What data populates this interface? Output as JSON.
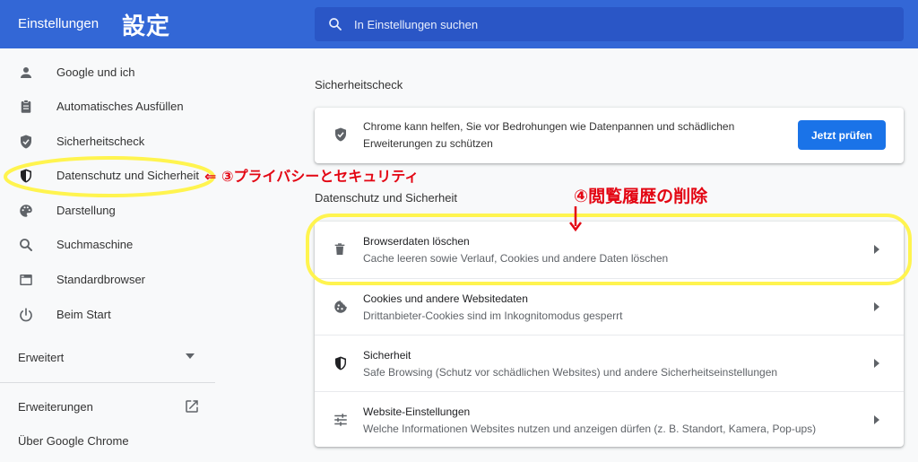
{
  "header": {
    "title": "Einstellungen",
    "annotation_title": "設定",
    "search_placeholder": "In Einstellungen suchen"
  },
  "sidebar": {
    "items": [
      {
        "label": "Google und ich",
        "icon": "person-icon"
      },
      {
        "label": "Automatisches Ausfüllen",
        "icon": "clipboard-icon"
      },
      {
        "label": "Sicherheitscheck",
        "icon": "shield-check-icon"
      },
      {
        "label": "Datenschutz und Sicherheit",
        "icon": "shield-icon"
      },
      {
        "label": "Darstellung",
        "icon": "palette-icon"
      },
      {
        "label": "Suchmaschine",
        "icon": "search-icon"
      },
      {
        "label": "Standardbrowser",
        "icon": "browser-window-icon"
      },
      {
        "label": "Beim Start",
        "icon": "power-icon"
      }
    ],
    "advanced_label": "Erweitert",
    "extensions_label": "Erweiterungen",
    "about_label": "Über Google Chrome"
  },
  "safety_check": {
    "section_title": "Sicherheitscheck",
    "description_line1": "Chrome kann helfen, Sie vor Bedrohungen wie Datenpannen und schädlichen",
    "description_line2": "Erweiterungen zu schützen",
    "button_label": "Jetzt prüfen"
  },
  "privacy": {
    "section_title": "Datenschutz und Sicherheit",
    "rows": [
      {
        "title": "Browserdaten löschen",
        "subtitle": "Cache leeren sowie Verlauf, Cookies und andere Daten löschen",
        "icon": "trash-icon"
      },
      {
        "title": "Cookies und andere Websitedaten",
        "subtitle": "Drittanbieter-Cookies sind im Inkognitomodus gesperrt",
        "icon": "cookie-icon"
      },
      {
        "title": "Sicherheit",
        "subtitle": "Safe Browsing (Schutz vor schädlichen Websites) und andere Sicherheitseinstellungen",
        "icon": "shield-icon"
      },
      {
        "title": "Website-Einstellungen",
        "subtitle": "Welche Informationen Websites nutzen und anzeigen dürfen (z. B. Standort, Kamera, Pop-ups)",
        "icon": "sliders-icon"
      }
    ]
  },
  "annotations": {
    "privacy_note": "⇐ ③プライバシーとセキュリティ",
    "history_note": "④閲覧履歴の削除"
  },
  "colors": {
    "header_bg": "#3367d6",
    "search_bg": "#2a56c6",
    "primary_button": "#1a73e8",
    "highlight": "#fff44f",
    "annotation_red": "#e30613"
  }
}
